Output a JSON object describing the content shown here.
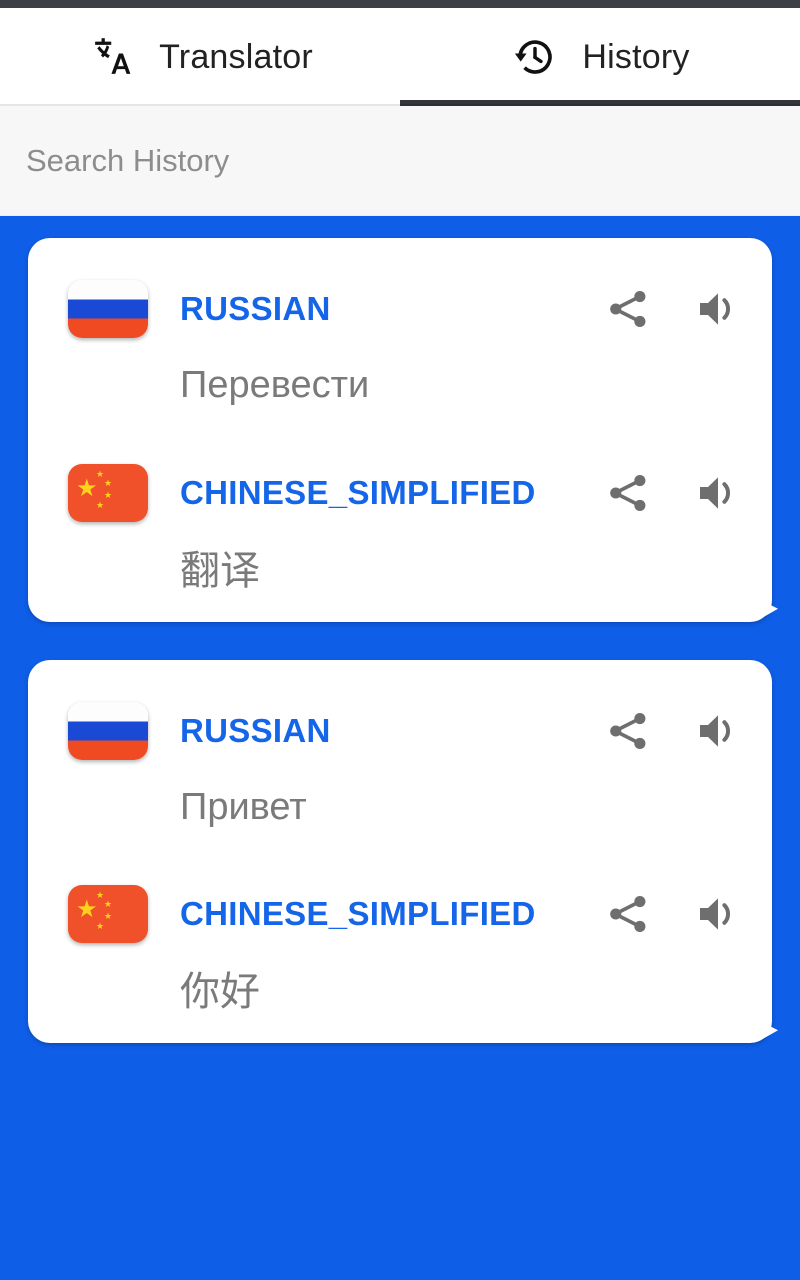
{
  "app": {
    "accent_blue": "#0f5ee8",
    "card_background": "#ffffff",
    "language_label_color": "#1565e8",
    "body_text_color": "#7a7a7a",
    "tab_indicator_color": "#33363a"
  },
  "tabs": [
    {
      "id": "translator",
      "label": "Translator",
      "icon": "translate-icon",
      "active": false
    },
    {
      "id": "history",
      "label": "History",
      "icon": "history-clock-icon",
      "active": true
    }
  ],
  "search": {
    "placeholder": "Search History",
    "value": ""
  },
  "history": {
    "cards": [
      {
        "entries": [
          {
            "flag": "russia-flag-icon",
            "language": "RUSSIAN",
            "text": "Перевести",
            "share_icon": "share-icon",
            "speak_icon": "volume-up-icon"
          },
          {
            "flag": "china-flag-icon",
            "language": "CHINESE_SIMPLIFIED",
            "text": "翻译",
            "share_icon": "share-icon",
            "speak_icon": "volume-up-icon"
          }
        ]
      },
      {
        "entries": [
          {
            "flag": "russia-flag-icon",
            "language": "RUSSIAN",
            "text": "Привет",
            "share_icon": "share-icon",
            "speak_icon": "volume-up-icon"
          },
          {
            "flag": "china-flag-icon",
            "language": "CHINESE_SIMPLIFIED",
            "text": "你好",
            "share_icon": "share-icon",
            "speak_icon": "volume-up-icon"
          }
        ]
      }
    ]
  }
}
